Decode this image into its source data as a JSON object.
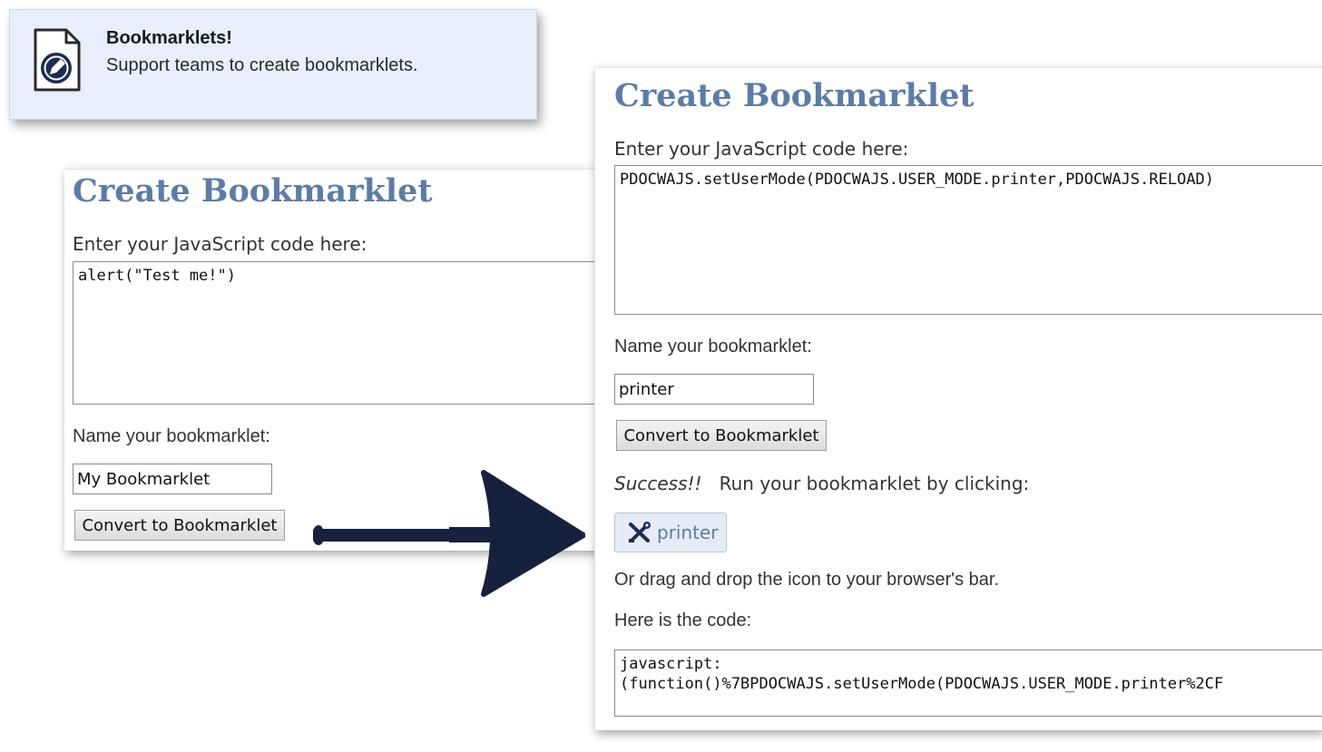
{
  "notification": {
    "title": "Bookmarklets!",
    "subtitle": "Support teams to create bookmarklets.",
    "icon": "document-pencil-icon"
  },
  "left_panel": {
    "title": "Create Bookmarklet",
    "code_label": "Enter your JavaScript code here:",
    "code_value": "alert(\"Test me!\")",
    "name_label": "Name your bookmarklet:",
    "name_value": "My Bookmarklet",
    "convert_button": "Convert to Bookmarklet"
  },
  "arrow": {
    "icon": "arrow-right-icon",
    "color": "#16213e"
  },
  "right_panel": {
    "title": "Create Bookmarklet",
    "code_label": "Enter your JavaScript code here:",
    "code_value": "PDOCWAJS.setUserMode(PDOCWAJS.USER_MODE.printer,PDOCWAJS.RELOAD)",
    "name_label": "Name your bookmarklet:",
    "name_value": "printer",
    "convert_button": "Convert to Bookmarklet",
    "success_word": "Success!!",
    "success_message": "Run your bookmarklet by clicking:",
    "bookmarklet_label": "printer",
    "bookmarklet_icon": "tools-icon",
    "drag_hint": "Or drag and drop the icon to your browser's bar.",
    "code_output_label": "Here is the code:",
    "code_output_line1": "javascript:",
    "code_output_line2": "(function()%7BPDOCWAJS.setUserMode(PDOCWAJS.USER_MODE.printer%2CF"
  },
  "colors": {
    "title": "#5b7cab",
    "notification_bg": "#e8eefb"
  }
}
